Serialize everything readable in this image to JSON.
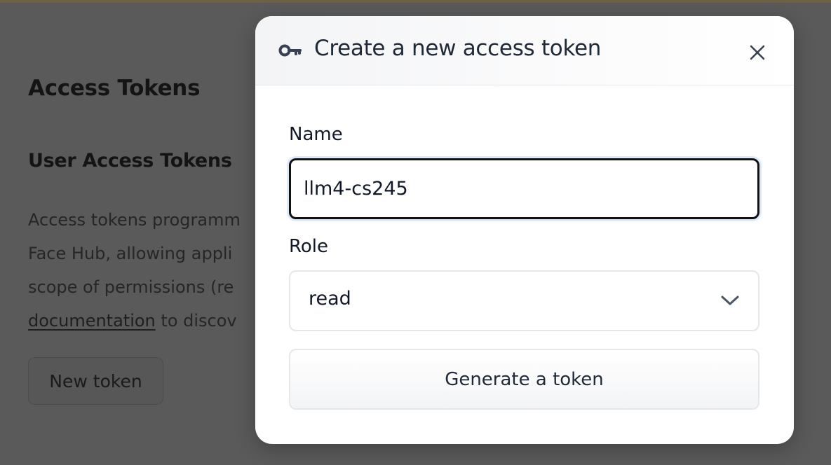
{
  "background": {
    "title": "Access Tokens",
    "subtitle": "User Access Tokens",
    "description_lines": [
      "Access tokens programm",
      "Face Hub, allowing appli",
      "scope of permissions (re"
    ],
    "link_text": "documentation",
    "link_suffix": " to discov",
    "new_token_button": "New token"
  },
  "modal": {
    "title": "Create a new access token",
    "icons": {
      "header": "key-icon",
      "close": "close-icon",
      "select": "chevron-down-icon"
    },
    "name_label": "Name",
    "name_value": "llm4-cs245",
    "role_label": "Role",
    "role_value": "read",
    "generate_button": "Generate a token"
  },
  "colors": {
    "overlay": "#5a5a5a",
    "focus_ring": "#dbeafe",
    "input_border": "#111111"
  }
}
